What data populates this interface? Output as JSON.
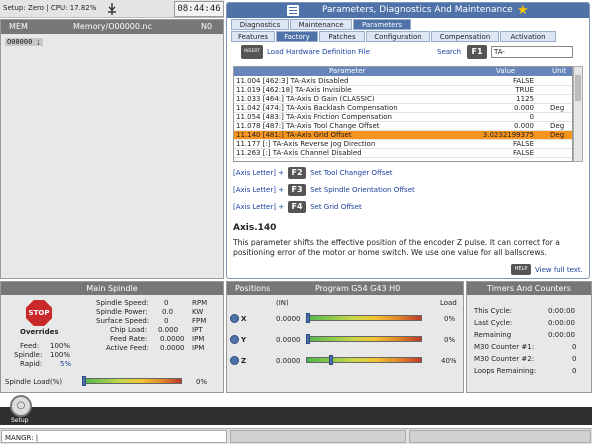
{
  "topbar": {
    "status_text": "Setup: Zero | CPU: 17.82%",
    "clock": "08:44:46"
  },
  "memory": {
    "mode": "MEM",
    "file": "Memory/O00000.nc",
    "n": "N0",
    "line": "O00000 ;"
  },
  "params": {
    "title": "Parameters, Diagnostics And Maintenance",
    "tabs_top": [
      "Diagnostics",
      "Maintenance",
      "Parameters"
    ],
    "tabs_sub": [
      "Features",
      "Factory",
      "Patches",
      "Configuration",
      "Compensation",
      "Activation"
    ],
    "insert_label": "INSERT",
    "load_label": "Load Hardware Definition File",
    "search_label": "Search",
    "search_key": "F1",
    "search_value": "TA-",
    "headers": {
      "param": "Parameter",
      "value": "Value",
      "unit": "Unit"
    },
    "rows": [
      {
        "name": "11.004 [462:3] TA-Axis Disabled",
        "value": "FALSE",
        "unit": ""
      },
      {
        "name": "11.019 [462:18] TA-Axis Invisible",
        "value": "TRUE",
        "unit": ""
      },
      {
        "name": "11.033 [464:] TA-Axis D Gain (CLASSIC)",
        "value": "1125",
        "unit": ""
      },
      {
        "name": "11.042 [474:] TA-Axis Backlash Compensation",
        "value": "0.000",
        "unit": "Deg"
      },
      {
        "name": "11.054 [483:] TA-Axis Friction Compensation",
        "value": "0",
        "unit": ""
      },
      {
        "name": "11.078 [487:] TA-Axis Tool Change Offset",
        "value": "0.000",
        "unit": "Deg"
      },
      {
        "name": "11.140 [481:] TA-Axis Grid Offset",
        "value": "3.0232199375",
        "unit": "Deg"
      },
      {
        "name": "11.177 [:] TA-Axis Reverse Jog Direction",
        "value": "FALSE",
        "unit": ""
      },
      {
        "name": "11.263 [:] TA-Axis Channel Disabled",
        "value": "FALSE",
        "unit": ""
      }
    ],
    "shortcuts": [
      {
        "prefix": "[Axis Letter] +",
        "key": "F2",
        "label": "Set Tool Changer Offset"
      },
      {
        "prefix": "[Axis Letter] +",
        "key": "F3",
        "label": "Set Spindle Orientation Offset"
      },
      {
        "prefix": "[Axis Letter] +",
        "key": "F4",
        "label": "Set Grid Offset"
      }
    ],
    "desc_title": "Axis.140",
    "desc_text": "This parameter shifts the effective position of the encoder Z pulse. It can correct for a positioning error of the motor or home switch. We use one value for all ballscrews.",
    "help_label": "HELP",
    "full_text": "View full text."
  },
  "spindle": {
    "title": "Main Spindle",
    "stop": "STOP",
    "overrides": "Overrides",
    "feed_label": "Feed:",
    "feed": "100%",
    "spindle_label": "Spindle:",
    "spindle_val": "100%",
    "rapid_label": "Rapid:",
    "rapid": "5%",
    "stats": [
      {
        "label": "Spindle Speed:",
        "value": "0",
        "unit": "RPM"
      },
      {
        "label": "Spindle Power:",
        "value": "0.0",
        "unit": "KW"
      },
      {
        "label": "Surface Speed:",
        "value": "0",
        "unit": "FPM"
      },
      {
        "label": "Chip Load:",
        "value": "0.000",
        "unit": "IPT"
      },
      {
        "label": "Feed Rate:",
        "value": "0.0000",
        "unit": "IPM"
      },
      {
        "label": "Active Feed:",
        "value": "0.0000",
        "unit": "IPM"
      }
    ],
    "load_label": "Spindle Load(%)",
    "load_value": "0%",
    "load_fraction": 0
  },
  "positions": {
    "title": "Positions",
    "program": "Program G54 G43 H0",
    "in_label": "(IN)",
    "load_label": "Load",
    "axes": [
      {
        "axis": "X",
        "value": "0.0000",
        "load": "0%",
        "fraction": 0
      },
      {
        "axis": "Y",
        "value": "0.0000",
        "load": "0%",
        "fraction": 0
      },
      {
        "axis": "Z",
        "value": "0.0000",
        "load": "40%",
        "fraction": 0.2
      }
    ]
  },
  "timers": {
    "title": "Timers And Counters",
    "items": [
      {
        "label": "This Cycle:",
        "value": "0:00:00"
      },
      {
        "label": "Last Cycle:",
        "value": "0:00:00"
      },
      {
        "label": "Remaining",
        "value": "0:00:00"
      },
      {
        "label": "M30 Counter #1:",
        "value": "0"
      },
      {
        "label": "M30 Counter #2:",
        "value": "0"
      },
      {
        "label": "Loops Remaining:",
        "value": "0"
      }
    ]
  },
  "bottom": {
    "setup_label": "Setup",
    "mangr": "MANGR: |"
  }
}
